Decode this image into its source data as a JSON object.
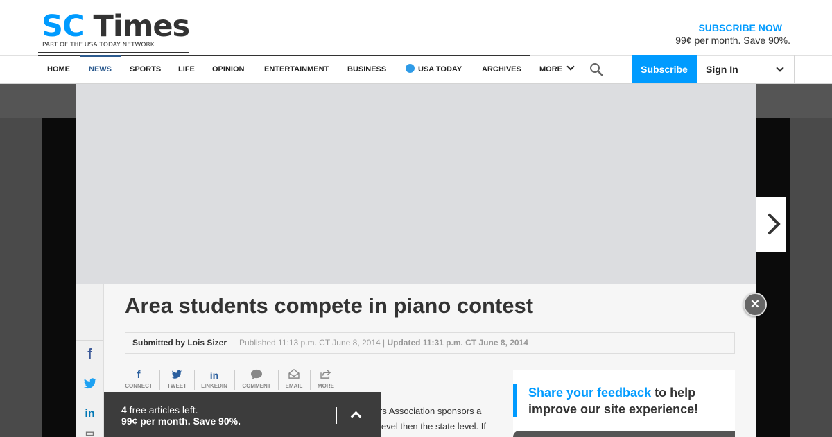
{
  "header": {
    "logo_sc": "SC",
    "logo_times": "Times",
    "logo_tagline": "PART OF THE USA TODAY NETWORK",
    "subscribe_now": "SUBSCRIBE NOW",
    "subscribe_offer": "99¢ per month. Save 90%."
  },
  "nav": {
    "items": [
      "HOME",
      "NEWS",
      "SPORTS",
      "LIFE",
      "OPINION",
      "ENTERTAINMENT",
      "BUSINESS",
      "USA TODAY",
      "ARCHIVES",
      "MORE"
    ],
    "active": "NEWS",
    "subscribe_button": "Subscribe",
    "sign_in": "Sign In"
  },
  "article": {
    "title": "Area students compete in piano contest",
    "author": "Submitted by Lois Sizer",
    "published": "Published 11:13 p.m. CT June 8, 2014 | ",
    "updated": "Updated 11:31 p.m. CT June 8, 2014",
    "body_line1": "rs Association sponsors a",
    "body_line2": "level then the state level. If"
  },
  "share": {
    "items": [
      {
        "icon": "facebook-icon",
        "label": "CONNECT"
      },
      {
        "icon": "twitter-icon",
        "label": "TWEET"
      },
      {
        "icon": "linkedin-icon",
        "label": "LINKEDIN"
      },
      {
        "icon": "comment-icon",
        "label": "COMMENT"
      },
      {
        "icon": "email-icon",
        "label": "EMAIL"
      },
      {
        "icon": "share-icon",
        "label": "MORE"
      }
    ]
  },
  "feedback": {
    "highlight": "Share your feedback",
    "rest": " to help improve our site experience!"
  },
  "toast": {
    "count": "4",
    "free_text": " free articles left.",
    "offer": "99¢ per month. Save 90%."
  },
  "colors": {
    "brand_blue": "#009bff",
    "nav_active": "#2d5b8f",
    "toast_bg": "#3c3c3c"
  }
}
